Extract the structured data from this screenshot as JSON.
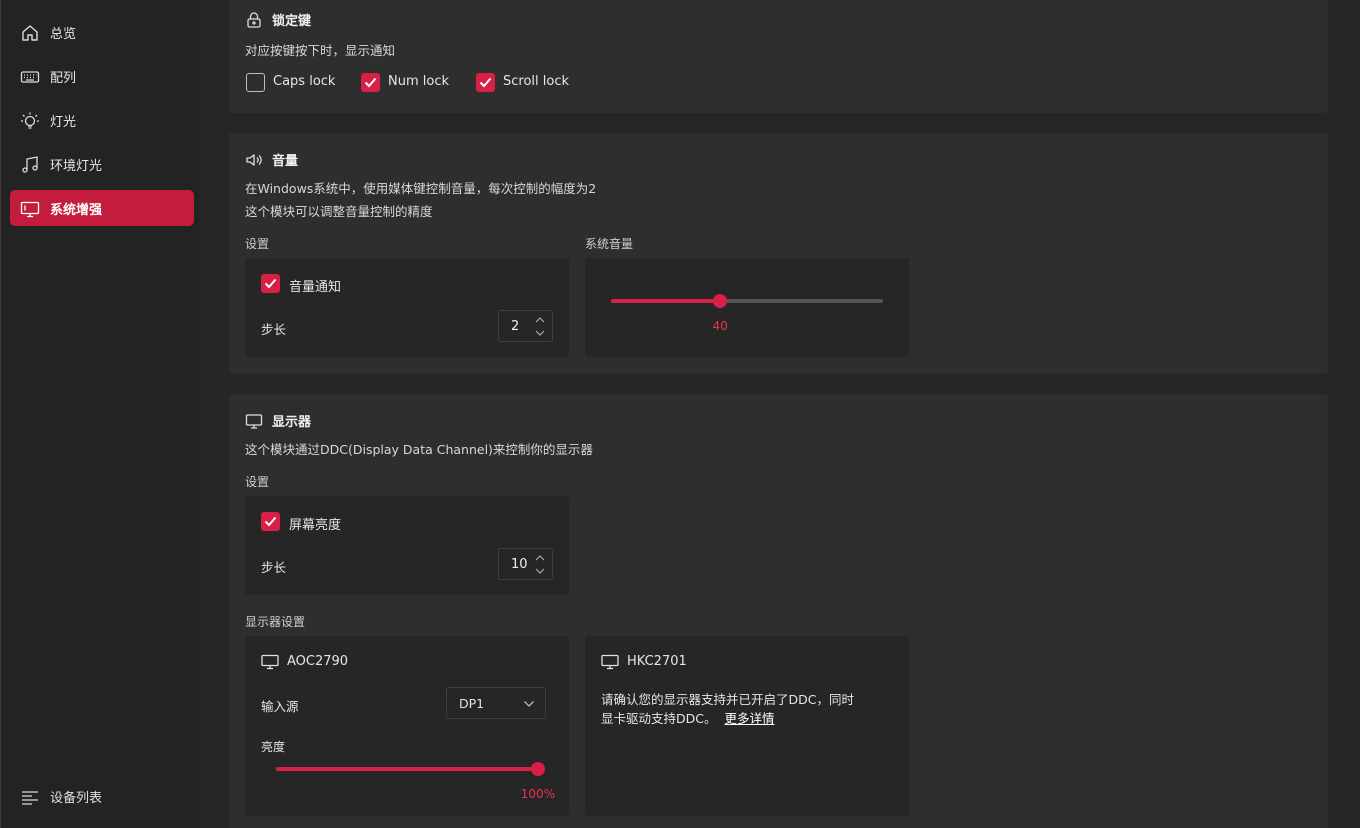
{
  "sidebar": {
    "items": [
      {
        "label": "总览",
        "icon": "home-icon"
      },
      {
        "label": "配列",
        "icon": "keyboard-icon"
      },
      {
        "label": "灯光",
        "icon": "lightbulb-icon"
      },
      {
        "label": "环境灯光",
        "icon": "music-note-icon"
      },
      {
        "label": "系统增强",
        "icon": "monitor-icon"
      }
    ],
    "active_index": 4,
    "bottom": {
      "label": "设备列表",
      "icon": "list-icon"
    }
  },
  "lock_keys": {
    "title": "锁定键",
    "icon": "lock-icon",
    "description": "对应按键按下时，显示通知",
    "options": [
      {
        "label": "Caps lock",
        "checked": false
      },
      {
        "label": "Num lock",
        "checked": true
      },
      {
        "label": "Scroll lock",
        "checked": true
      }
    ]
  },
  "volume": {
    "title": "音量",
    "icon": "speaker-icon",
    "desc1": "在Windows系统中，使用媒体键控制音量，每次控制的幅度为2",
    "desc2": "这个模块可以调整音量控制的精度",
    "settings_label": "设置",
    "system_volume_label": "系统音量",
    "notify_label": "音量通知",
    "notify_checked": true,
    "step_label": "步长",
    "step_value": "2",
    "system_volume_value": 40,
    "system_volume_text": "40"
  },
  "display": {
    "title": "显示器",
    "icon": "display-icon",
    "description": "这个模块通过DDC(Display Data Channel)来控制你的显示器",
    "settings_label": "设置",
    "brightness_label": "屏幕亮度",
    "brightness_checked": true,
    "step_label": "步长",
    "step_value": "10",
    "monitor_settings_label": "显示器设置",
    "monitors": [
      {
        "name": "AOC2790",
        "input_label": "输入源",
        "input_value": "DP1",
        "brightness_label": "亮度",
        "brightness_value": 100,
        "brightness_text": "100%"
      },
      {
        "name": "HKC2701",
        "message_line1": "请确认您的显示器支持并已开启了DDC，同时",
        "message_line2": "显卡驱动支持DDC。",
        "link_text": "更多详情"
      }
    ]
  },
  "colors": {
    "accent": "#d81f45",
    "sidebar_active": "#c41c3d"
  }
}
